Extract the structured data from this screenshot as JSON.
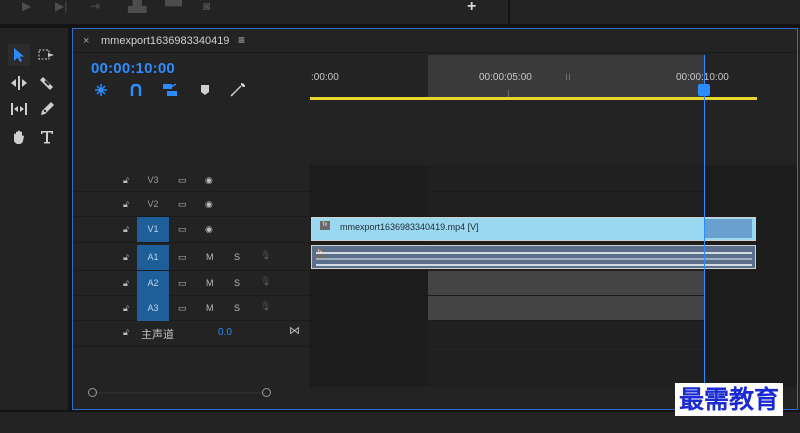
{
  "tab": {
    "close": "×",
    "title": "mmexport1636983340419",
    "menu": "≡"
  },
  "timecode": "00:00:10:00",
  "ruler": {
    "labels": [
      ":00:00",
      "00:00:05:00",
      "00:00:10:00"
    ]
  },
  "tracks": {
    "v3": "V3",
    "v2": "V2",
    "v1": "V1",
    "a1": "A1",
    "a2": "A2",
    "a3": "A3",
    "mute": "M",
    "solo": "S"
  },
  "clip": {
    "name": "mmexport1636983340419.mp4 [V]",
    "fx": "fx"
  },
  "master": {
    "label": "主声道",
    "value": "0.0"
  },
  "watermark": "最需教育",
  "colors": {
    "accent": "#2b8cff",
    "work_area": "#e9d62b",
    "video_clip": "#9ad8f0",
    "audio_clip": "#5b6f8a",
    "track_target": "#1e5f9a"
  },
  "icons": {
    "tools": [
      "selection-icon",
      "track-select-icon",
      "ripple-edit-icon",
      "razor-icon",
      "slip-icon",
      "pen-icon",
      "hand-icon",
      "type-icon"
    ],
    "controls": [
      "snap-nest-icon",
      "snap-icon",
      "linked-selection-icon",
      "add-marker-icon",
      "settings-wrench-icon"
    ]
  }
}
